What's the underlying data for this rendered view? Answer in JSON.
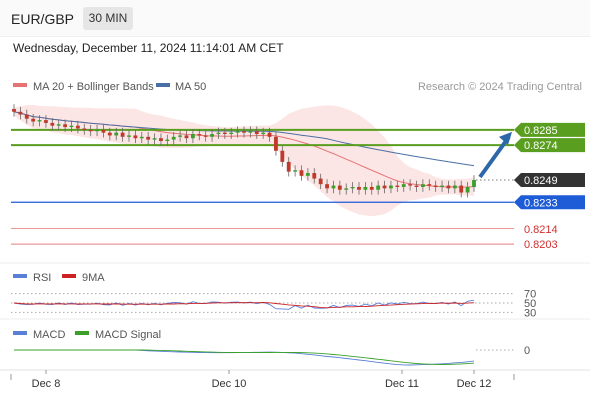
{
  "header": {
    "symbol": "EUR/GBP",
    "timeframe": "30 MIN",
    "datetime": "Wednesday, December 11, 2024 11:14:01 AM CET"
  },
  "colors": {
    "ma20": "#e57373",
    "band_fill": "#fbdcdc",
    "ma50": "#4a6fa5",
    "resistance": "#5a9e1f",
    "support": "#1e5bd6",
    "minor_support": "#d32f2f",
    "last_price": "#333333",
    "arrow": "#2c67a8",
    "rsi": "#5b7fd6",
    "rsi_ma": "#cc2222",
    "macd": "#5b7fd6",
    "macd_signal": "#3aa02a"
  },
  "chart_data": [
    {
      "type": "candlestick",
      "legend": [
        "MA 20 + Bollinger Bands",
        "MA 50"
      ],
      "source": "Research © 2024 Trading Central",
      "x_ticks": [
        "Dec 8",
        "Dec 10",
        "Dec 11",
        "Dec 12"
      ],
      "ylim": [
        0.8193,
        0.8305
      ],
      "closes": [
        0.8298,
        0.8296,
        0.8293,
        0.8291,
        0.8292,
        0.829,
        0.8288,
        0.8289,
        0.8287,
        0.8288,
        0.8286,
        0.8285,
        0.8284,
        0.8285,
        0.8283,
        0.8281,
        0.8283,
        0.828,
        0.8281,
        0.8279,
        0.828,
        0.8278,
        0.8279,
        0.8277,
        0.8278,
        0.828,
        0.8281,
        0.8279,
        0.8282,
        0.8281,
        0.828,
        0.8282,
        0.8283,
        0.8282,
        0.8283,
        0.8284,
        0.8283,
        0.8284,
        0.8282,
        0.8283,
        0.828,
        0.827,
        0.8262,
        0.8255,
        0.8256,
        0.8252,
        0.8254,
        0.825,
        0.8246,
        0.8243,
        0.8245,
        0.8242,
        0.8243,
        0.8244,
        0.8242,
        0.8244,
        0.8242,
        0.8245,
        0.8243,
        0.8245,
        0.8244,
        0.8246,
        0.8245,
        0.8244,
        0.8246,
        0.8245,
        0.8244,
        0.8245,
        0.8243,
        0.8245,
        0.824,
        0.8244,
        0.8249
      ],
      "levels": {
        "resistance": [
          0.8285,
          0.8274
        ],
        "last": 0.8249,
        "support": 0.8233,
        "minor_support": [
          0.8214,
          0.8203
        ]
      },
      "level_labels": [
        "0.8285",
        "0.8274",
        "0.8249",
        "0.8233",
        "0.8214",
        "0.8203"
      ]
    },
    {
      "type": "line",
      "legend": [
        "RSI",
        "9MA"
      ],
      "levels": [
        70,
        50,
        30
      ],
      "level_labels": [
        "70",
        "50",
        "30"
      ],
      "ylim": [
        20,
        80
      ]
    },
    {
      "type": "line",
      "legend": [
        "MACD",
        "MACD Signal"
      ],
      "zero_label": "0"
    }
  ]
}
